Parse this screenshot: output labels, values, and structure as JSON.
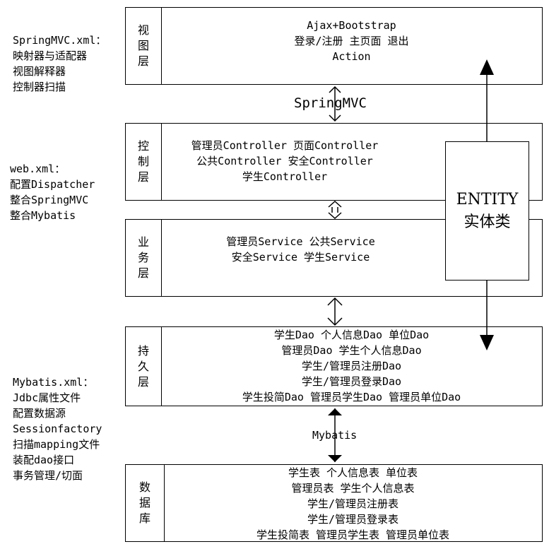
{
  "left_notes": {
    "springmvc_config": [
      "SpringMVC.xml：",
      "映射器与适配器",
      "视图解释器",
      "控制器扫描"
    ],
    "web_config": [
      "web.xml：",
      "配置Dispatcher",
      "整合SpringMVC",
      "整合Mybatis"
    ],
    "mybatis_config": [
      "Mybatis.xml：",
      "Jdbc属性文件",
      "配置数据源",
      "Sessionfactory",
      "扫描mapping文件",
      "装配dao接口",
      "事务管理/切面"
    ]
  },
  "layers": {
    "view": {
      "label": [
        "视",
        "图",
        "层"
      ],
      "lines": [
        "Ajax+Bootstrap",
        "登录/注册 主页面 退出",
        "Action"
      ]
    },
    "control": {
      "label": [
        "控",
        "制",
        "层"
      ],
      "lines": [
        "管理员Controller 页面Controller",
        "公共Controller 安全Controller",
        "学生Controller"
      ]
    },
    "service": {
      "label": [
        "业",
        "务",
        "层"
      ],
      "lines": [
        "管理员Service 公共Service",
        "安全Service 学生Service"
      ]
    },
    "persistence": {
      "label": [
        "持",
        "久",
        "层"
      ],
      "lines": [
        "学生Dao 个人信息Dao 单位Dao",
        "管理员Dao 学生个人信息Dao",
        "学生/管理员注册Dao",
        "学生/管理员登录Dao",
        "学生投简Dao 管理员学生Dao 管理员单位Dao"
      ]
    },
    "database": {
      "label": [
        "数",
        "据",
        "库"
      ],
      "lines": [
        "学生表 个人信息表 单位表",
        "管理员表 学生个人信息表",
        "学生/管理员注册表",
        "学生/管理员登录表",
        "学生投简表 管理员学生表 管理员单位表"
      ]
    }
  },
  "connectors": {
    "springmvc": "SpringMVC",
    "mybatis": "Mybatis"
  },
  "entity": {
    "line1": "ENTITY",
    "line2": "实体类"
  }
}
